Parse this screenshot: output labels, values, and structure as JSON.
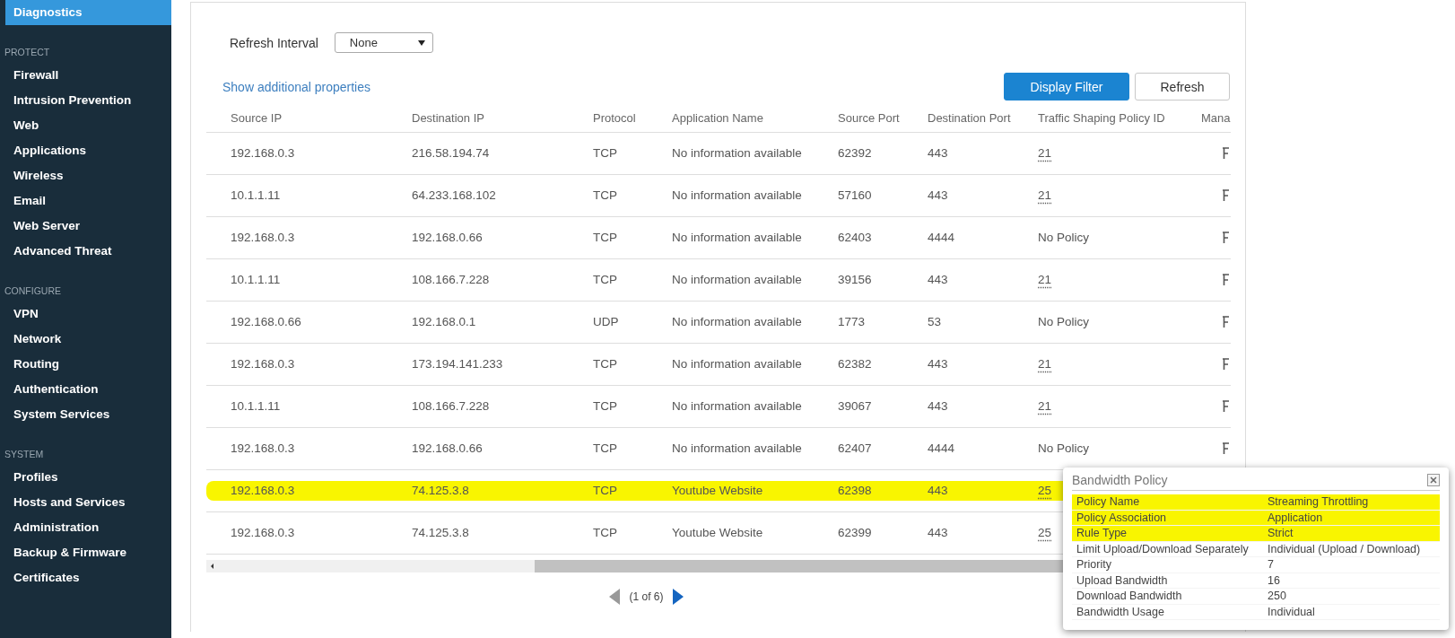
{
  "sidebar": {
    "sections": [
      {
        "items": [
          {
            "label": "Diagnostics",
            "selected": true
          }
        ]
      },
      {
        "heading": "PROTECT",
        "items": [
          {
            "label": "Firewall",
            "selected": false
          },
          {
            "label": "Intrusion Prevention",
            "selected": false
          },
          {
            "label": "Web",
            "selected": false
          },
          {
            "label": "Applications",
            "selected": false
          },
          {
            "label": "Wireless",
            "selected": false
          },
          {
            "label": "Email",
            "selected": false
          },
          {
            "label": "Web Server",
            "selected": false
          },
          {
            "label": "Advanced Threat",
            "selected": false
          }
        ]
      },
      {
        "heading": "CONFIGURE",
        "items": [
          {
            "label": "VPN",
            "selected": false
          },
          {
            "label": "Network",
            "selected": false
          },
          {
            "label": "Routing",
            "selected": false
          },
          {
            "label": "Authentication",
            "selected": false
          },
          {
            "label": "System Services",
            "selected": false
          }
        ]
      },
      {
        "heading": "SYSTEM",
        "items": [
          {
            "label": "Profiles",
            "selected": false
          },
          {
            "label": "Hosts and Services",
            "selected": false
          },
          {
            "label": "Administration",
            "selected": false
          },
          {
            "label": "Backup & Firmware",
            "selected": false
          },
          {
            "label": "Certificates",
            "selected": false
          }
        ]
      }
    ]
  },
  "refresh_interval": {
    "label": "Refresh Interval",
    "value": "None"
  },
  "additional_properties_link": "Show additional properties",
  "buttons": [
    {
      "label": "Display Filter",
      "kind": "primary"
    },
    {
      "label": "Refresh",
      "kind": "secondary"
    }
  ],
  "table": {
    "columns": [
      "Source IP",
      "Destination IP",
      "Protocol",
      "Application Name",
      "Source Port",
      "Destination Port",
      "Traffic Shaping Policy ID",
      "Mana"
    ],
    "rows": [
      {
        "cells": [
          "192.168.0.3",
          "216.58.194.74",
          "TCP",
          "No information available",
          "62392",
          "443"
        ],
        "policy": {
          "text": "21",
          "linked": true
        },
        "highlighted": false
      },
      {
        "cells": [
          "10.1.1.11",
          "64.233.168.102",
          "TCP",
          "No information available",
          "57160",
          "443"
        ],
        "policy": {
          "text": "21",
          "linked": true
        },
        "highlighted": false
      },
      {
        "cells": [
          "192.168.0.3",
          "192.168.0.66",
          "TCP",
          "No information available",
          "62403",
          "4444"
        ],
        "policy": {
          "text": "No Policy",
          "linked": false
        },
        "highlighted": false
      },
      {
        "cells": [
          "10.1.1.11",
          "108.166.7.228",
          "TCP",
          "No information available",
          "39156",
          "443"
        ],
        "policy": {
          "text": "21",
          "linked": true
        },
        "highlighted": false
      },
      {
        "cells": [
          "192.168.0.66",
          "192.168.0.1",
          "UDP",
          "No information available",
          "1773",
          "53"
        ],
        "policy": {
          "text": "No Policy",
          "linked": false
        },
        "highlighted": false
      },
      {
        "cells": [
          "192.168.0.3",
          "173.194.141.233",
          "TCP",
          "No information available",
          "62382",
          "443"
        ],
        "policy": {
          "text": "21",
          "linked": true
        },
        "highlighted": false
      },
      {
        "cells": [
          "10.1.1.11",
          "108.166.7.228",
          "TCP",
          "No information available",
          "39067",
          "443"
        ],
        "policy": {
          "text": "21",
          "linked": true
        },
        "highlighted": false
      },
      {
        "cells": [
          "192.168.0.3",
          "192.168.0.66",
          "TCP",
          "No information available",
          "62407",
          "4444"
        ],
        "policy": {
          "text": "No Policy",
          "linked": false
        },
        "highlighted": false
      },
      {
        "cells": [
          "192.168.0.3",
          "74.125.3.8",
          "TCP",
          "Youtube Website",
          "62398",
          "443"
        ],
        "policy": {
          "text": "25",
          "linked": true
        },
        "highlighted": true
      },
      {
        "cells": [
          "192.168.0.3",
          "74.125.3.8",
          "TCP",
          "Youtube Website",
          "62399",
          "443"
        ],
        "policy": {
          "text": "25",
          "linked": true
        },
        "highlighted": false
      }
    ]
  },
  "pagination": {
    "text": "(1 of 6)",
    "prev_disabled": true,
    "next_disabled": false
  },
  "popup": {
    "title": "Bandwidth Policy",
    "fields": [
      {
        "label": "Policy Name",
        "value": "Streaming Throttling",
        "highlighted": true
      },
      {
        "label": "Policy Association",
        "value": "Application",
        "highlighted": true
      },
      {
        "label": "Rule Type",
        "value": "Strict",
        "highlighted": true
      },
      {
        "label": "Limit Upload/Download Separately",
        "value": "Individual (Upload / Download)",
        "highlighted": false
      },
      {
        "label": "Priority",
        "value": "7",
        "highlighted": false
      },
      {
        "label": "Upload Bandwidth",
        "value": "16",
        "highlighted": false
      },
      {
        "label": "Download Bandwidth",
        "value": "250",
        "highlighted": false
      },
      {
        "label": "Bandwidth Usage",
        "value": "Individual",
        "highlighted": false
      }
    ]
  }
}
